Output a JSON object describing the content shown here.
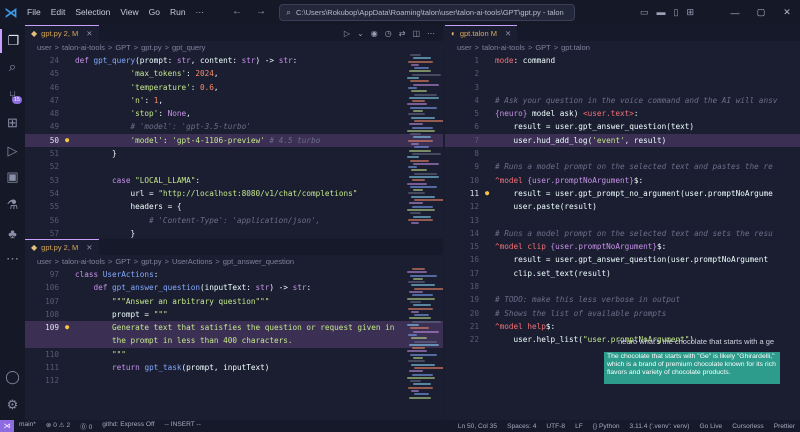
{
  "window": {
    "menu": [
      "File",
      "Edit",
      "Selection",
      "View",
      "Go",
      "Run",
      "···"
    ],
    "command_center": "C:\\Users\\Rokubop\\AppData\\Roaming\\talon\\user\\talon-ai-tools\\GPT\\gpt.py - talon",
    "icons": {
      "back": "arrow-left-icon",
      "forward": "arrow-right-icon",
      "search": "search-icon"
    }
  },
  "activity": [
    "explorer-icon",
    "search-icon",
    "source-control-icon",
    "extensions-icon",
    "run-debug-icon",
    "remote-explorer-icon",
    "testing-icon",
    "tree-icon",
    "more-icon",
    "account-icon",
    "settings-icon"
  ],
  "activity_badge": "15",
  "left_top": {
    "tab": "gpt.py 2, M",
    "crumbs": [
      "user",
      ">",
      "talon-ai-tools",
      ">",
      "GPT",
      ">",
      "gpt.py",
      ">",
      "gpt_query"
    ],
    "lines": [
      {
        "n": "24",
        "tokens": [
          [
            "kw",
            "def "
          ],
          [
            "fn",
            "gpt_query"
          ],
          [
            "var",
            "(prompt: "
          ],
          [
            "kw",
            "str"
          ],
          [
            "var",
            ", content: "
          ],
          [
            "kw",
            "str"
          ],
          [
            "var",
            ") -> "
          ],
          [
            "kw",
            "str"
          ],
          [
            "var",
            ":"
          ]
        ]
      },
      {
        "n": "45",
        "tokens": [
          [
            "str",
            "            'max_tokens'"
          ],
          [
            "var",
            ": "
          ],
          [
            "num",
            "2024"
          ],
          [
            "var",
            ","
          ]
        ]
      },
      {
        "n": "46",
        "tokens": [
          [
            "str",
            "            'temperature'"
          ],
          [
            "var",
            ": "
          ],
          [
            "num",
            "0.6"
          ],
          [
            "var",
            ","
          ]
        ]
      },
      {
        "n": "47",
        "tokens": [
          [
            "str",
            "            'n'"
          ],
          [
            "var",
            ": "
          ],
          [
            "num",
            "1"
          ],
          [
            "var",
            ","
          ]
        ]
      },
      {
        "n": "48",
        "tokens": [
          [
            "str",
            "            'stop'"
          ],
          [
            "var",
            ": "
          ],
          [
            "kw",
            "None"
          ],
          [
            "var",
            ","
          ]
        ]
      },
      {
        "n": "49",
        "tokens": [
          [
            "cmt",
            "            # 'model': 'gpt-3.5-turbo'"
          ]
        ]
      },
      {
        "n": "50",
        "tokens": [
          [
            "str",
            "            'model'"
          ],
          [
            "var",
            ": "
          ],
          [
            "str",
            "'gpt-4-1106-preview'"
          ],
          [
            "cmt",
            " # 4.5 turbo"
          ]
        ],
        "highlight": true,
        "current": true,
        "bulb": true
      },
      {
        "n": "51",
        "tokens": [
          [
            "var",
            "        }"
          ]
        ]
      },
      {
        "n": "52",
        "tokens": [
          [
            "var",
            ""
          ]
        ]
      },
      {
        "n": "53",
        "tokens": [
          [
            "kw",
            "        case "
          ],
          [
            "str",
            "\"LOCAL_LLAMA\""
          ],
          [
            "var",
            ":"
          ]
        ]
      },
      {
        "n": "54",
        "tokens": [
          [
            "var",
            "            url = "
          ],
          [
            "str",
            "\"http://localhost:8080/v1/chat/completions\""
          ]
        ]
      },
      {
        "n": "55",
        "tokens": [
          [
            "var",
            "            headers = {"
          ]
        ]
      },
      {
        "n": "56",
        "tokens": [
          [
            "cmt",
            "                # 'Content-Type': 'application/json',"
          ]
        ]
      },
      {
        "n": "57",
        "tokens": [
          [
            "var",
            "            }"
          ]
        ]
      }
    ]
  },
  "left_bottom": {
    "tab": "gpt.py 2, M",
    "crumbs": [
      "user",
      ">",
      "talon-ai-tools",
      ">",
      "GPT",
      ">",
      "gpt.py",
      ">",
      "UserActions",
      ">",
      "gpt_answer_question"
    ],
    "lines": [
      {
        "n": "97",
        "tokens": [
          [
            "kw",
            "class "
          ],
          [
            "fn",
            "UserActions"
          ],
          [
            "var",
            ":"
          ]
        ]
      },
      {
        "n": "106",
        "tokens": [
          [
            "kw",
            "    def "
          ],
          [
            "fn",
            "gpt_answer_question"
          ],
          [
            "var",
            "(inputText: "
          ],
          [
            "kw",
            "str"
          ],
          [
            "var",
            ") -> "
          ],
          [
            "kw",
            "str"
          ],
          [
            "var",
            ":"
          ]
        ]
      },
      {
        "n": "107",
        "tokens": [
          [
            "str",
            "        \"\"\"Answer an arbitrary question\"\"\""
          ]
        ]
      },
      {
        "n": "108",
        "tokens": [
          [
            "var",
            "        prompt = "
          ],
          [
            "str",
            "\"\"\""
          ]
        ]
      },
      {
        "n": "109",
        "tokens": [
          [
            "str",
            "        Generate text that satisfies the question or request given in"
          ]
        ],
        "highlight": true,
        "current": true,
        "bulb": true
      },
      {
        "n": "",
        "tokens": [
          [
            "str",
            "        the prompt in less than 400 characters."
          ]
        ],
        "highlight": true
      },
      {
        "n": "110",
        "tokens": [
          [
            "str",
            "        \"\"\""
          ]
        ]
      },
      {
        "n": "111",
        "tokens": [
          [
            "kw",
            "        return "
          ],
          [
            "fn",
            "gpt_task"
          ],
          [
            "var",
            "(prompt, inputText)"
          ]
        ]
      },
      {
        "n": "112",
        "tokens": [
          [
            "var",
            ""
          ]
        ]
      }
    ]
  },
  "right": {
    "tab": "gpt.talon M",
    "crumbs": [
      "user",
      ">",
      "talon-ai-tools",
      ">",
      "GPT",
      ">",
      "gpt.talon"
    ],
    "lines": [
      {
        "n": "1",
        "tokens": [
          [
            "param",
            "mode"
          ],
          [
            "var",
            ": command"
          ]
        ]
      },
      {
        "n": "2",
        "tokens": [
          [
            "var",
            ""
          ]
        ]
      },
      {
        "n": "3",
        "tokens": [
          [
            "var",
            ""
          ]
        ]
      },
      {
        "n": "4",
        "tokens": [
          [
            "cmt",
            "# Ask your question in the voice command and the AI will ansv"
          ]
        ]
      },
      {
        "n": "5",
        "tokens": [
          [
            "kw",
            "{neuro}"
          ],
          [
            "var",
            " model ask) "
          ],
          [
            "param",
            "<user.text>"
          ],
          [
            "var",
            ":"
          ]
        ]
      },
      {
        "n": "6",
        "tokens": [
          [
            "var",
            "    result = user.gpt_answer_question(text)"
          ]
        ]
      },
      {
        "n": "7",
        "tokens": [
          [
            "var",
            "    user.hud_add_log("
          ],
          [
            "str",
            "'event'"
          ],
          [
            "var",
            ", result)"
          ]
        ],
        "highlight": true
      },
      {
        "n": "8",
        "tokens": [
          [
            "var",
            ""
          ]
        ]
      },
      {
        "n": "9",
        "tokens": [
          [
            "cmt",
            "# Runs a model prompt on the selected text and pastes the re"
          ]
        ]
      },
      {
        "n": "10",
        "tokens": [
          [
            "param",
            "^model "
          ],
          [
            "kw",
            "{user.promptNoArgument}"
          ],
          [
            "var",
            "$:"
          ]
        ]
      },
      {
        "n": "11",
        "tokens": [
          [
            "var",
            "    result = user.gpt_prompt_no_argument(user.promptNoArgume"
          ]
        ],
        "current": true,
        "bulb": true
      },
      {
        "n": "12",
        "tokens": [
          [
            "var",
            "    user.paste(result)"
          ]
        ]
      },
      {
        "n": "13",
        "tokens": [
          [
            "var",
            ""
          ]
        ]
      },
      {
        "n": "14",
        "tokens": [
          [
            "cmt",
            "# Runs a model prompt on the selected text and sets the resu"
          ]
        ]
      },
      {
        "n": "15",
        "tokens": [
          [
            "param",
            "^model clip "
          ],
          [
            "kw",
            "{user.promptNoArgument}"
          ],
          [
            "var",
            "$:"
          ]
        ]
      },
      {
        "n": "16",
        "tokens": [
          [
            "var",
            "    result = user.gpt_answer_question(user.promptNoArgument"
          ]
        ]
      },
      {
        "n": "17",
        "tokens": [
          [
            "var",
            "    clip.set_text(result)"
          ]
        ]
      },
      {
        "n": "18",
        "tokens": [
          [
            "var",
            ""
          ]
        ]
      },
      {
        "n": "19",
        "tokens": [
          [
            "cmt",
            "# TODO: make this less verbose in output"
          ]
        ]
      },
      {
        "n": "20",
        "tokens": [
          [
            "cmt",
            "# Shows the list of available prompts"
          ]
        ]
      },
      {
        "n": "21",
        "tokens": [
          [
            "param",
            "^model help"
          ],
          [
            "var",
            "$:"
          ]
        ]
      },
      {
        "n": "22",
        "tokens": [
          [
            "var",
            "    user.help_list("
          ],
          [
            "str",
            "\"user.promptNoArgument\""
          ],
          [
            "var",
            ")"
          ]
        ]
      }
    ]
  },
  "talon": {
    "question": "neuro what's the chocolate that starts with a ge",
    "answer": "The chocolate that starts with \"Ge\" is likely \"Ghirardelli,\" which is a brand of premium chocolate known for its rich flavors and variety of chocolate products."
  },
  "status": {
    "left": [
      "main*",
      "⊗ 0 ⚠ 2",
      "⓪ 0",
      "githd: Express Off",
      "-- INSERT --"
    ],
    "right": [
      "Ln 50, Col 35",
      "Spaces: 4",
      "UTF-8",
      "LF",
      "{} Python",
      "3.11.4 ('.venv': venv)",
      "Go Live",
      "Cursorless",
      "Prettier"
    ]
  },
  "colors": {
    "accent": "#8c6ce0",
    "talon_answer_bg": "#2e9c8c"
  }
}
